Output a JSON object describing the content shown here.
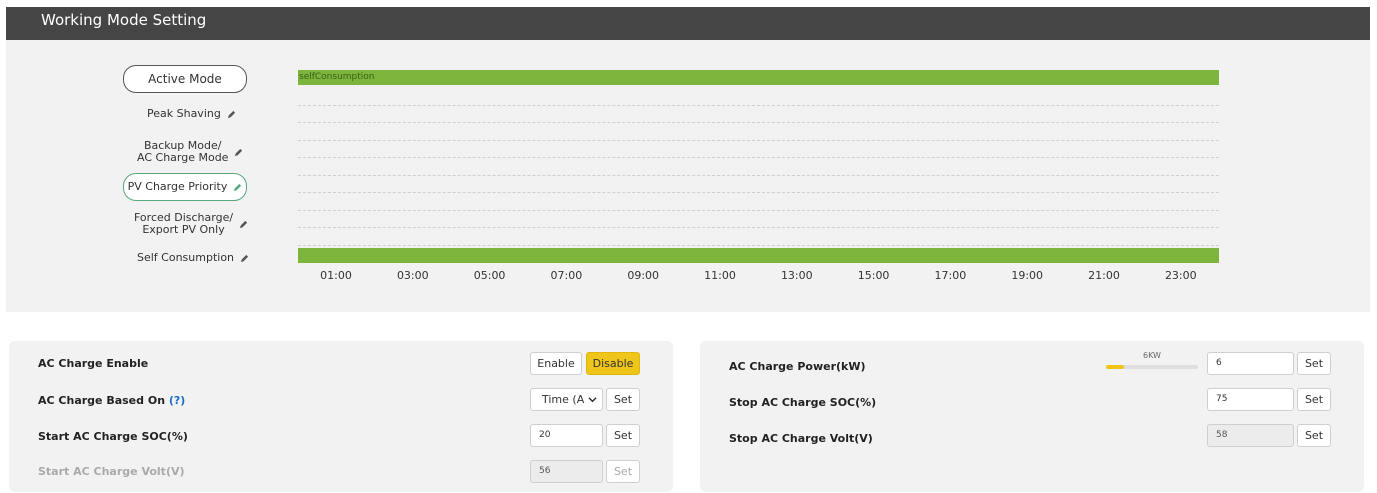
{
  "header": {
    "title": "Working Mode Setting"
  },
  "modes": {
    "active_mode": "Active Mode",
    "peak_shaving": "Peak Shaving",
    "backup_line1": "Backup Mode/",
    "backup_line2": "AC Charge Mode",
    "pv_charge_priority": "PV Charge Priority",
    "forced_line1": "Forced Discharge/",
    "forced_line2": "Export PV Only",
    "self_consumption": "Self Consumption",
    "pencil_icon": "pencil-icon"
  },
  "chart_data": {
    "type": "bar",
    "bar_label": "selfConsumption",
    "ticks": [
      "01:00",
      "03:00",
      "05:00",
      "07:00",
      "09:00",
      "11:00",
      "13:00",
      "15:00",
      "17:00",
      "19:00",
      "21:00",
      "23:00"
    ],
    "bar_color": "#7db43b"
  },
  "left_panel": {
    "ac_charge_enable": "AC Charge Enable",
    "enable_label": "Enable",
    "disable_label": "Disable",
    "ac_charge_based_on": "AC Charge Based On",
    "help": "(?)",
    "based_on_value": "Time (A",
    "set_label": "Set",
    "start_soc_label": "Start AC Charge SOC(%)",
    "start_soc_value": "20",
    "start_volt_label": "Start AC Charge Volt(V)",
    "start_volt_value": "56"
  },
  "right_panel": {
    "power_label": "AC Charge Power(kW)",
    "power_max": "6KW",
    "power_value": "6",
    "power_fraction": 0.2,
    "stop_soc_label": "Stop AC Charge SOC(%)",
    "stop_soc_value": "75",
    "stop_volt_label": "Stop AC Charge Volt(V)",
    "stop_volt_value": "58",
    "set_label": "Set"
  },
  "colors": {
    "accent": "#f0c51a",
    "green": "#7db43b",
    "header": "#454545"
  }
}
